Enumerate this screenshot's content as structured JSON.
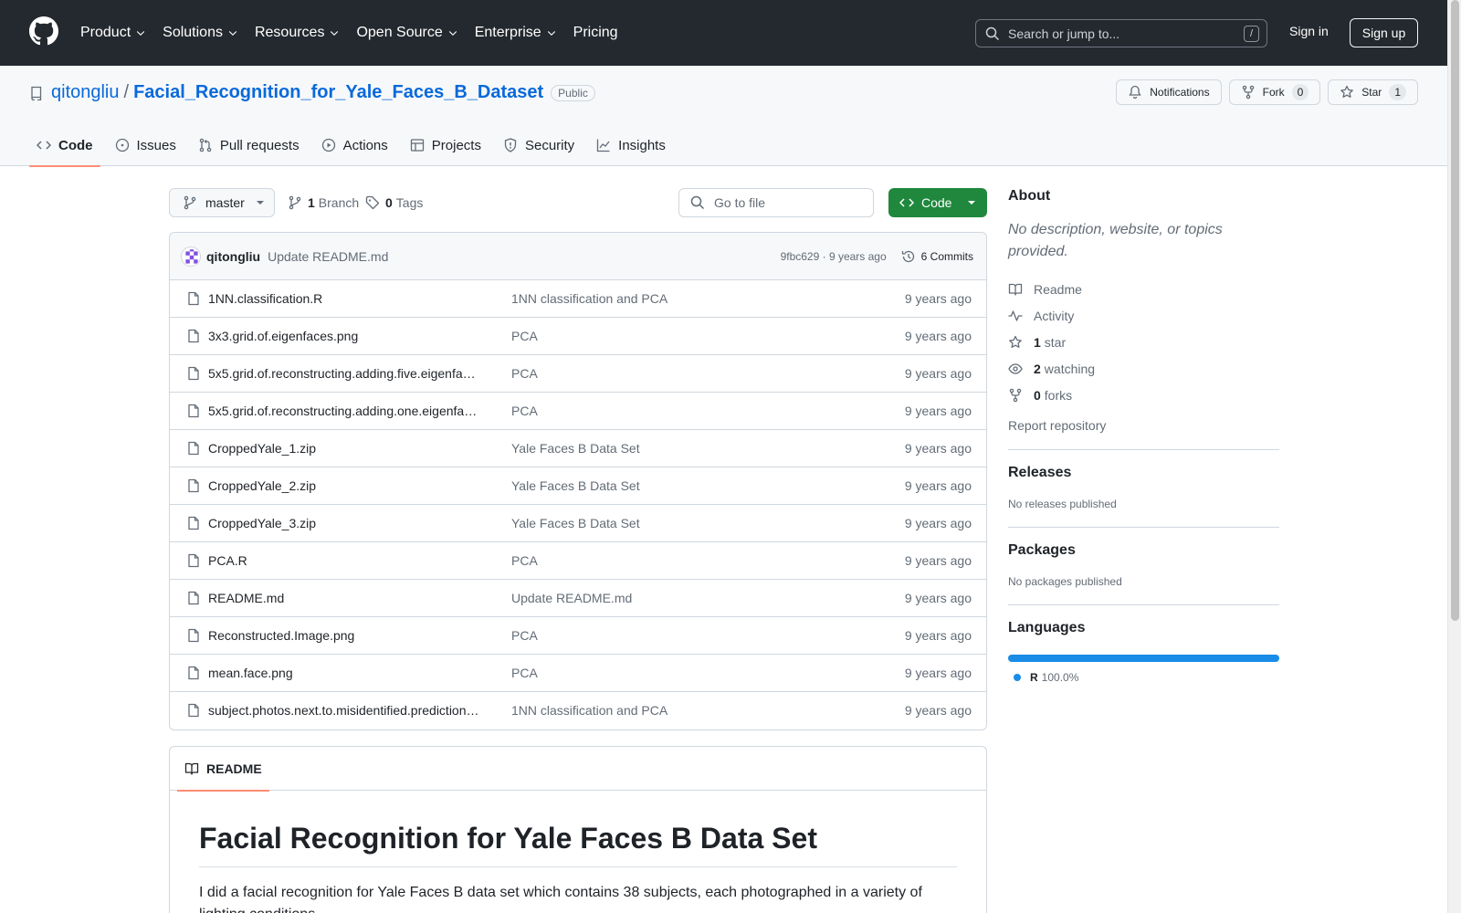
{
  "header": {
    "nav": [
      {
        "label": "Product",
        "dropdown": true
      },
      {
        "label": "Solutions",
        "dropdown": true
      },
      {
        "label": "Resources",
        "dropdown": true
      },
      {
        "label": "Open Source",
        "dropdown": true
      },
      {
        "label": "Enterprise",
        "dropdown": true
      },
      {
        "label": "Pricing",
        "dropdown": false
      }
    ],
    "search_placeholder": "Search or jump to...",
    "search_shortcut": "/",
    "sign_in": "Sign in",
    "sign_up": "Sign up"
  },
  "repo": {
    "owner": "qitongliu",
    "separator": "/",
    "name": "Facial_Recognition_for_Yale_Faces_B_Dataset",
    "visibility": "Public",
    "actions": {
      "notifications": "Notifications",
      "fork": "Fork",
      "fork_count": "0",
      "star": "Star",
      "star_count": "1"
    },
    "tabs": [
      {
        "label": "Code",
        "icon": "code-icon",
        "active": true
      },
      {
        "label": "Issues",
        "icon": "issue-icon",
        "active": false
      },
      {
        "label": "Pull requests",
        "icon": "pull-request-icon",
        "active": false
      },
      {
        "label": "Actions",
        "icon": "play-icon",
        "active": false
      },
      {
        "label": "Projects",
        "icon": "table-icon",
        "active": false
      },
      {
        "label": "Security",
        "icon": "shield-icon",
        "active": false
      },
      {
        "label": "Insights",
        "icon": "graph-icon",
        "active": false
      }
    ]
  },
  "toolbar": {
    "branch": "master",
    "branch_count": "1",
    "branch_label": "Branch",
    "tag_count": "0",
    "tag_label": "Tags",
    "goto_placeholder": "Go to file",
    "code_button": "Code"
  },
  "commit": {
    "author": "qitongliu",
    "message": "Update README.md",
    "sha_time": "9fbc629 · 9 years ago",
    "commits": "6 Commits"
  },
  "files": [
    {
      "name": "1NN.classification.R",
      "message": "1NN classification and PCA",
      "time": "9 years ago"
    },
    {
      "name": "3x3.grid.of.eigenfaces.png",
      "message": "PCA",
      "time": "9 years ago"
    },
    {
      "name": "5x5.grid.of.reconstructing.adding.five.eigenfa…",
      "message": "PCA",
      "time": "9 years ago"
    },
    {
      "name": "5x5.grid.of.reconstructing.adding.one.eigenfa…",
      "message": "PCA",
      "time": "9 years ago"
    },
    {
      "name": "CroppedYale_1.zip",
      "message": "Yale Faces B Data Set",
      "time": "9 years ago"
    },
    {
      "name": "CroppedYale_2.zip",
      "message": "Yale Faces B Data Set",
      "time": "9 years ago"
    },
    {
      "name": "CroppedYale_3.zip",
      "message": "Yale Faces B Data Set",
      "time": "9 years ago"
    },
    {
      "name": "PCA.R",
      "message": "PCA",
      "time": "9 years ago"
    },
    {
      "name": "README.md",
      "message": "Update README.md",
      "time": "9 years ago"
    },
    {
      "name": "Reconstructed.Image.png",
      "message": "PCA",
      "time": "9 years ago"
    },
    {
      "name": "mean.face.png",
      "message": "PCA",
      "time": "9 years ago"
    },
    {
      "name": "subject.photos.next.to.misidentified.prediction…",
      "message": "1NN classification and PCA",
      "time": "9 years ago"
    }
  ],
  "readme": {
    "tab": "README",
    "title": "Facial Recognition for Yale Faces B Data Set",
    "paragraph": "I did a facial recognition for Yale Faces B data set which contains 38 subjects, each photographed in a variety of lighting conditions."
  },
  "sidebar": {
    "about_title": "About",
    "about_desc": "No description, website, or topics provided.",
    "links": {
      "readme": "Readme",
      "activity": "Activity",
      "stars_count": "1",
      "stars_label": "star",
      "watching_count": "2",
      "watching_label": "watching",
      "forks_count": "0",
      "forks_label": "forks"
    },
    "report": "Report repository",
    "releases_title": "Releases",
    "releases_empty": "No releases published",
    "packages_title": "Packages",
    "packages_empty": "No packages published",
    "languages_title": "Languages",
    "language": {
      "name": "R",
      "percent": "100.0%",
      "fraction": 1.0,
      "color": "#198CE7"
    }
  },
  "colors": {
    "header_bg": "#24292f",
    "link": "#0969da",
    "primary_button": "#1f883d",
    "active_tab_underline": "#fd8c73"
  }
}
